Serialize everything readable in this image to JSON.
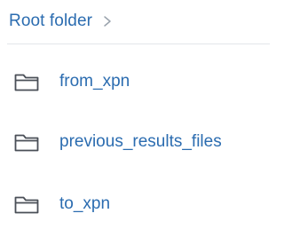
{
  "breadcrumb": {
    "root_label": "Root folder",
    "separator_icon": "chevron-right-icon"
  },
  "folders": [
    {
      "name": "from_xpn",
      "icon": "folder-icon"
    },
    {
      "name": "previous_results_files",
      "icon": "folder-icon"
    },
    {
      "name": "to_xpn",
      "icon": "folder-icon"
    }
  ],
  "colors": {
    "link": "#2b6cb0",
    "icon_stroke": "#4a4f57",
    "separator": "#9aa3ad",
    "divider": "#e3e6ea",
    "background": "#ffffff"
  }
}
